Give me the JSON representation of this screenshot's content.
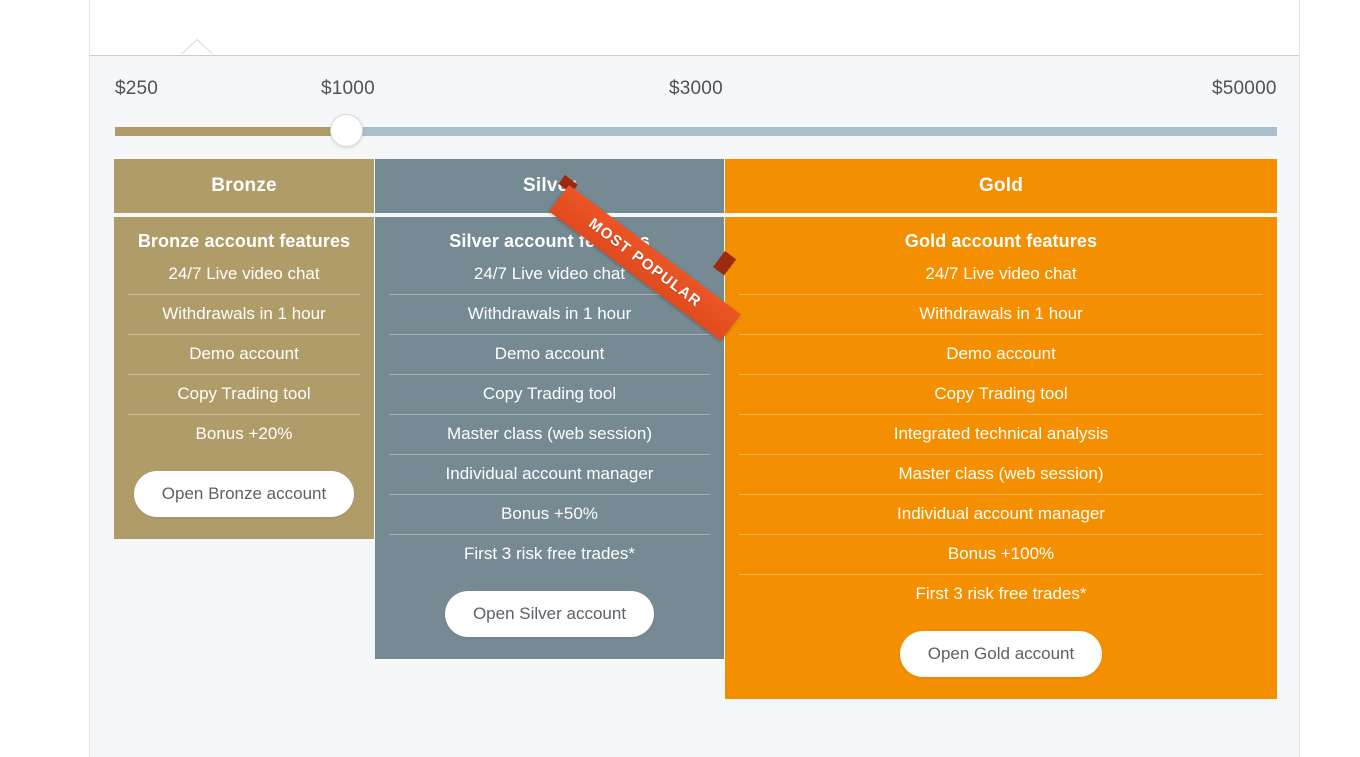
{
  "slider": {
    "ticks": [
      "$250",
      "$1000",
      "$3000",
      "$50000"
    ],
    "selected_value": "$1000",
    "fill_color": "#b09c68",
    "track_color": "#a9bfcb",
    "handle_color": "#ffffff"
  },
  "ribbon": {
    "label": "MOST POPULAR",
    "color": "#ec5526"
  },
  "plans": [
    {
      "id": "bronze",
      "title": "Bronze",
      "subtitle": "Bronze account features",
      "color": "#b09c68",
      "cta": "Open Bronze account",
      "features": [
        "24/7 Live video chat",
        "Withdrawals in 1 hour",
        "Demo account",
        "Copy Trading tool",
        "Bonus +20%"
      ]
    },
    {
      "id": "silver",
      "title": "Silver",
      "subtitle": "Silver account features",
      "color": "#758a92",
      "cta": "Open Silver account",
      "features": [
        "24/7 Live video chat",
        "Withdrawals in 1 hour",
        "Demo account",
        "Copy Trading tool",
        "Master class (web session)",
        "Individual account manager",
        "Bonus +50%",
        "First 3 risk free trades*"
      ]
    },
    {
      "id": "gold",
      "title": "Gold",
      "subtitle": "Gold account features",
      "color": "#f38f00",
      "cta": "Open Gold account",
      "features": [
        "24/7 Live video chat",
        "Withdrawals in 1 hour",
        "Demo account",
        "Copy Trading tool",
        "Integrated technical analysis",
        "Master class (web session)",
        "Individual account manager",
        "Bonus +100%",
        "First 3 risk free trades*"
      ]
    }
  ]
}
